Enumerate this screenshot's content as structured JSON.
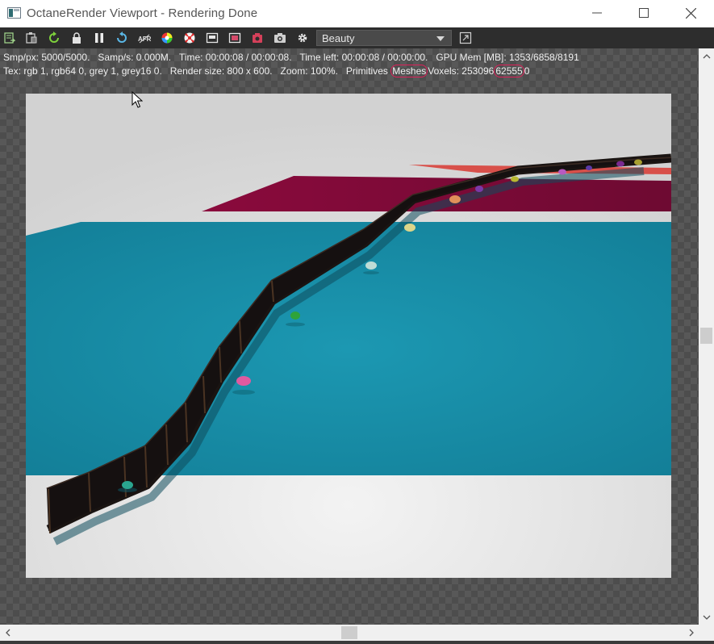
{
  "window": {
    "title": "OctaneRender Viewport - Rendering Done"
  },
  "toolbar": {
    "buttons": [
      {
        "icon": "export-icon"
      },
      {
        "icon": "clipboard-icon"
      },
      {
        "icon": "refresh-icon"
      },
      {
        "icon": "lock-icon"
      },
      {
        "icon": "pause-icon"
      },
      {
        "icon": "restart-icon"
      },
      {
        "icon": "afr-icon"
      },
      {
        "icon": "color-picker-icon"
      },
      {
        "icon": "lens-icon"
      },
      {
        "icon": "region-icon"
      },
      {
        "icon": "film-region-icon"
      },
      {
        "icon": "camera-lock-icon"
      },
      {
        "icon": "camera-icon"
      },
      {
        "icon": "settings-icon"
      },
      {
        "icon": "expand-icon"
      }
    ],
    "render_pass": {
      "value": "Beauty",
      "options": [
        "Beauty"
      ]
    }
  },
  "status": {
    "line1": "Smp/px: 5000/5000.   Samp/s: 0.000M.   Time: 00:00:08 / 00:00:08.   Time left: 00:00:08 / 00:00:00.   GPU Mem [MB]: 1353/6858/8191",
    "line2_prefix": "Tex: rgb 1, rgb64 0, grey 1, grey16 0.   Render size: 800 x 600.   Zoom: 100%.   Primitives",
    "line2_meshes": "Meshes",
    "line2_mid": "Voxels: 253096",
    "line2_voxels": "62555",
    "line2_suffix": "0"
  },
  "render": {
    "colors": {
      "floor": "#1890a8",
      "back_plane": "#7a0a35",
      "far_plane": "#d8504a",
      "background": "#e4e4e4",
      "fence": "#1a1412"
    },
    "pumpkin_colors": [
      "#2aa58f",
      "#e05aa0",
      "#2fa33a",
      "#bfdcd6",
      "#dcd58a",
      "#e0905a",
      "#7a3aa8",
      "#b8b830",
      "#b85ac0",
      "#5a3aa8",
      "#7a2a90",
      "#a8a030"
    ]
  },
  "accent_colors": {
    "titlebar": "#ffffff",
    "toolbar": "#2d2d2d",
    "highlight": "#e0205a"
  }
}
